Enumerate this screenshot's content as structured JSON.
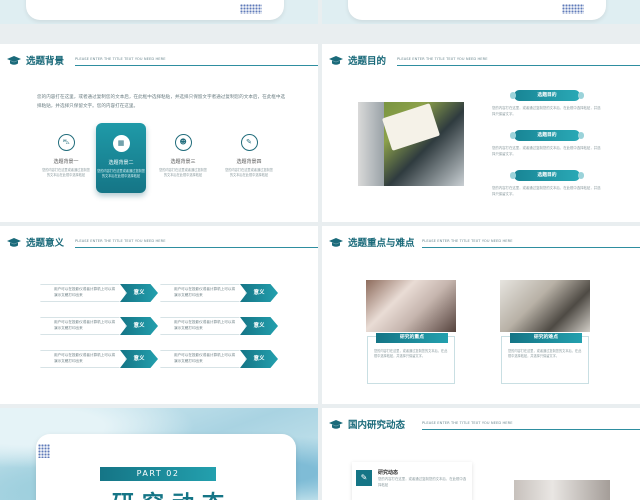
{
  "common": {
    "header_sub": "PLEASE ENTER THE TITLE TEXT YOU NEED HERE"
  },
  "slide1": {
    "title": "选题背景",
    "paragraph": "您的内容打在这里，或者通过复制您的文本后，在此框中选择粘贴，并选择只保留文字者通过复制您的文本后，在此框中选择粘贴，并选择只保留文字。您的内容打在这里。",
    "items": [
      {
        "label": "选题背景一",
        "desc": "您的内容打在这里或者通过复制您的文本后在此框中选择粘贴"
      },
      {
        "label": "选题背景二",
        "desc": "您的内容打在这里或者通过复制您的文本后在此框中选择粘贴"
      },
      {
        "label": "选题背景三",
        "desc": "您的内容打在这里或者通过复制您的文本后在此框中选择粘贴"
      },
      {
        "label": "选题背景四",
        "desc": "您的内容打在这里或者通过复制您的文本后在此框中选择粘贴"
      }
    ]
  },
  "slide2": {
    "title": "选题目的",
    "goals": [
      {
        "label": "选题目的",
        "text": "您的内容打在这里，或者通过复制您的文本后，在此框中选择粘贴，并选择只保留文字。"
      },
      {
        "label": "选题目的",
        "text": "您的内容打在这里，或者通过复制您的文本后，在此框中选择粘贴，并选择只保留文字。"
      },
      {
        "label": "选题目的",
        "text": "您的内容打在这里，或者通过复制您的文本后，在此框中选择粘贴，并选择只保留文字。"
      }
    ]
  },
  "slide3": {
    "title": "选题意义",
    "items": [
      {
        "text": "用户可以在投影仪或者计算机上可以将演示文稿打印出来",
        "label": "意义"
      },
      {
        "text": "用户可以在投影仪或者计算机上可以将演示文稿打印出来",
        "label": "意义"
      },
      {
        "text": "用户可以在投影仪或者计算机上可以将演示文稿打印出来",
        "label": "意义"
      },
      {
        "text": "用户可以在投影仪或者计算机上可以将演示文稿打印出来",
        "label": "意义"
      },
      {
        "text": "用户可以在投影仪或者计算机上可以将演示文稿打印出来",
        "label": "意义"
      },
      {
        "text": "用户可以在投影仪或者计算机上可以将演示文稿打印出来",
        "label": "意义"
      }
    ]
  },
  "slide4": {
    "title": "选题重点与难点",
    "cards": [
      {
        "label": "研究的重点",
        "text": "您的内容打在这里，或者通过复制您的文本后，在此框中选择粘贴，并选择只保留文字。"
      },
      {
        "label": "研究的难点",
        "text": "您的内容打在这里，或者通过复制您的文本后，在此框中选择粘贴，并选择只保留文字。"
      }
    ]
  },
  "slide5": {
    "part": "PART 02",
    "big_title": "研究动态"
  },
  "slide6": {
    "title": "国内研究动态",
    "card_title": "研究动态",
    "card_text": "您的内容打在这里，或者通过复制您的文本后，在此框中选择粘贴"
  }
}
